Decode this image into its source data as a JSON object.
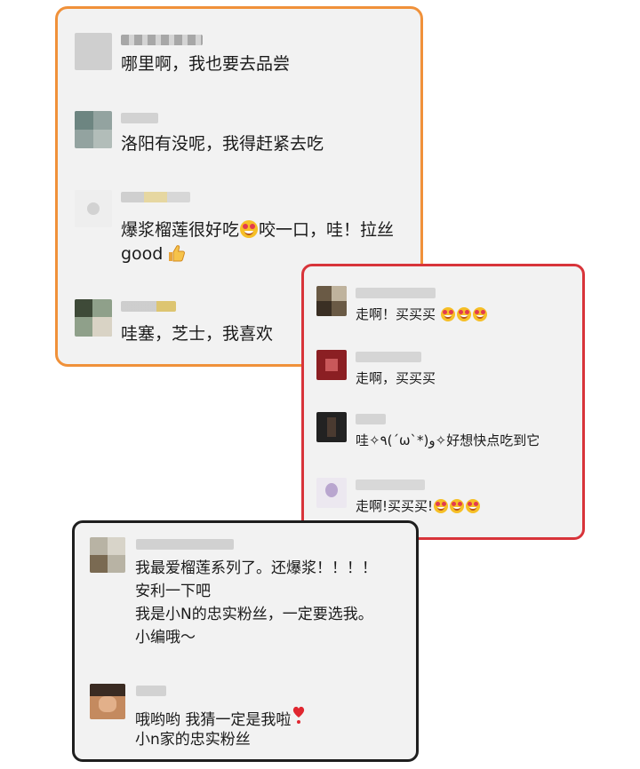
{
  "cards": {
    "orange": {
      "border_color": "#f0913a",
      "comments": [
        {
          "text": "哪里啊，我也要去品尝"
        },
        {
          "text": "洛阳有没呢，我得赶紧去吃"
        },
        {
          "text_a": "爆浆榴莲很好吃",
          "emoji": "star-struck-emoji",
          "text_b": "咬一口，哇！拉丝",
          "text_c": "good",
          "icon": "thumbs-up-icon"
        },
        {
          "text": "哇塞，芝士，我喜欢"
        }
      ]
    },
    "red": {
      "border_color": "#d8343a",
      "comments": [
        {
          "text": "走啊！买买买",
          "emoji": "star-struck-emoji",
          "emoji_count": 3
        },
        {
          "text": "走啊，买买买"
        },
        {
          "text": "哇✧٩(ˊωˋ*)و✧好想快点吃到它"
        },
        {
          "text": "走啊!买买买!",
          "emoji": "star-struck-emoji",
          "emoji_count": 3
        }
      ]
    },
    "black": {
      "border_color": "#1e1e1e",
      "comments": [
        {
          "lines": [
            "我最爱榴莲系列了。还爆浆！！！！",
            "安利一下吧",
            "我是小N的忠实粉丝，一定要选我。",
            "小编哦～"
          ]
        },
        {
          "line1": "哦哟哟 我猜一定是我啦",
          "icon": "red-heart-exclamation-icon",
          "line2": "小n家的忠实粉丝"
        }
      ]
    }
  }
}
